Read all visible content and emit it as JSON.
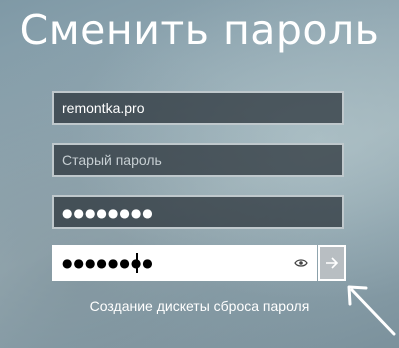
{
  "page": {
    "title": "Сменить пароль"
  },
  "fields": {
    "username": {
      "value": "remontka.pro"
    },
    "old_password": {
      "placeholder": "Старый пароль"
    },
    "new_password": {
      "masked_value": "●●●●●●●●"
    },
    "confirm_password": {
      "masked_value": "●●●●●●●●"
    }
  },
  "icons": {
    "reveal": "eye-icon",
    "submit": "arrow-right-icon",
    "annotation": "annotation-arrow-icon"
  },
  "links": {
    "reset_disk": "Создание дискеты сброса пароля"
  },
  "colors": {
    "text": "#ffffff",
    "field_border": "#bfc8cc",
    "active_field_bg": "#ffffff",
    "submit_bg": "#b8bec2"
  }
}
